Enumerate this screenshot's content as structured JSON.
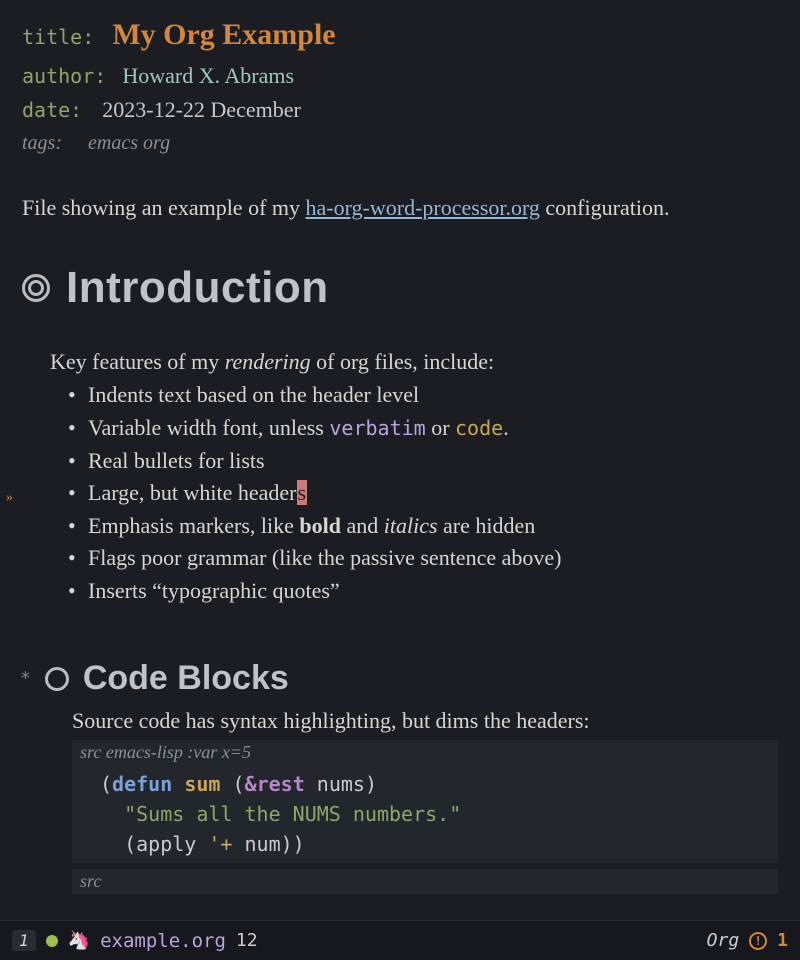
{
  "meta": {
    "title_key": "title",
    "title_val": "My Org Example",
    "author_key": "author",
    "author_val": "Howard X. Abrams",
    "date_key": "date",
    "date_val": "2023-12-22 December",
    "tags_key": "tags:",
    "tags_val": "emacs org"
  },
  "intro_para_pre": "File showing an example of my ",
  "intro_link": "ha-org-word-processor.org",
  "intro_para_post": " configuration.",
  "h1": "Introduction",
  "lead_pre": "Key features of my ",
  "lead_em": "rendering",
  "lead_post": " of org files, include:",
  "bullets": {
    "b1": "Indents text based on the header level",
    "b2_pre": "Variable width font, unless ",
    "b2_verbatim": "verbatim",
    "b2_mid": " or ",
    "b2_code": "code",
    "b2_post": ".",
    "b3": "Real bullets for lists",
    "b4_pre": "Large, but white header",
    "b4_cursor": "s",
    "b5_pre": "Emphasis markers, like ",
    "b5_bold": "bold",
    "b5_mid": " and ",
    "b5_italic": "italics",
    "b5_post": " are hidden",
    "b6": "Flags poor grammar (like the passive sentence above)",
    "b7": "Inserts “typographic quotes”"
  },
  "h2": "Code Blocks",
  "src": {
    "lead": "Source code has syntax highlighting, but dims the headers:",
    "begin_kw": "src",
    "begin_lang": " emacs-lisp :var x=5",
    "l1_open": "(",
    "l1_defun": "defun",
    "l1_sp1": " ",
    "l1_name": "sum",
    "l1_sp2": " (",
    "l1_rest": "&rest",
    "l1_args": " nums)",
    "l2_str": "  \"Sums all the NUMS numbers.\"",
    "l3_pre": "  (apply ",
    "l3_quote": "'+",
    "l3_post": " num))",
    "end_kw": "src"
  },
  "modeline": {
    "winnum": "1",
    "file": "example.org",
    "line": "12",
    "mode": "Org",
    "warn_glyph": "!",
    "warn_count": "1"
  }
}
